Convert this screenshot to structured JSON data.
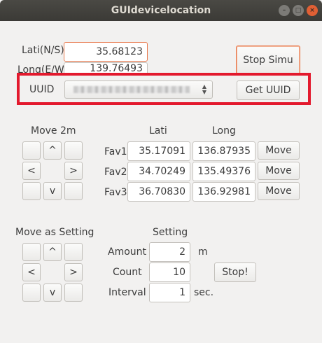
{
  "window": {
    "title": "GUIdevicelocation",
    "minimize_icon": "minimize-icon",
    "maximize_icon": "maximize-icon",
    "close_icon": "close-icon"
  },
  "location": {
    "lati_label": "Lati(N/S)",
    "lati_value": "35.68123",
    "long_label": "Long(E/W",
    "long_value": "139.76493",
    "stop_simu_label": "Stop Simu"
  },
  "uuid": {
    "label": "UUID",
    "get_uuid_label": "Get UUID"
  },
  "move": {
    "title": "Move 2m",
    "up": "^",
    "left": "<",
    "right": ">",
    "down": "v"
  },
  "favorites": {
    "lati_header": "Lati",
    "long_header": "Long",
    "move_label": "Move",
    "items": [
      {
        "label": "Fav1",
        "lati": "35.17091",
        "long": "136.87935"
      },
      {
        "label": "Fav2",
        "lati": "34.70249",
        "long": "135.49376"
      },
      {
        "label": "Fav3",
        "lati": "36.70830",
        "long": "136.92981"
      }
    ]
  },
  "move_setting": {
    "title": "Move as Setting",
    "up": "^",
    "left": "<",
    "right": ">",
    "down": "v"
  },
  "setting": {
    "title": "Setting",
    "amount_label": "Amount",
    "amount_value": "2",
    "amount_unit": "m",
    "count_label": "Count",
    "count_value": "10",
    "stop_label": "Stop!",
    "interval_label": "Interval",
    "interval_value": "1",
    "interval_unit": "sec."
  }
}
